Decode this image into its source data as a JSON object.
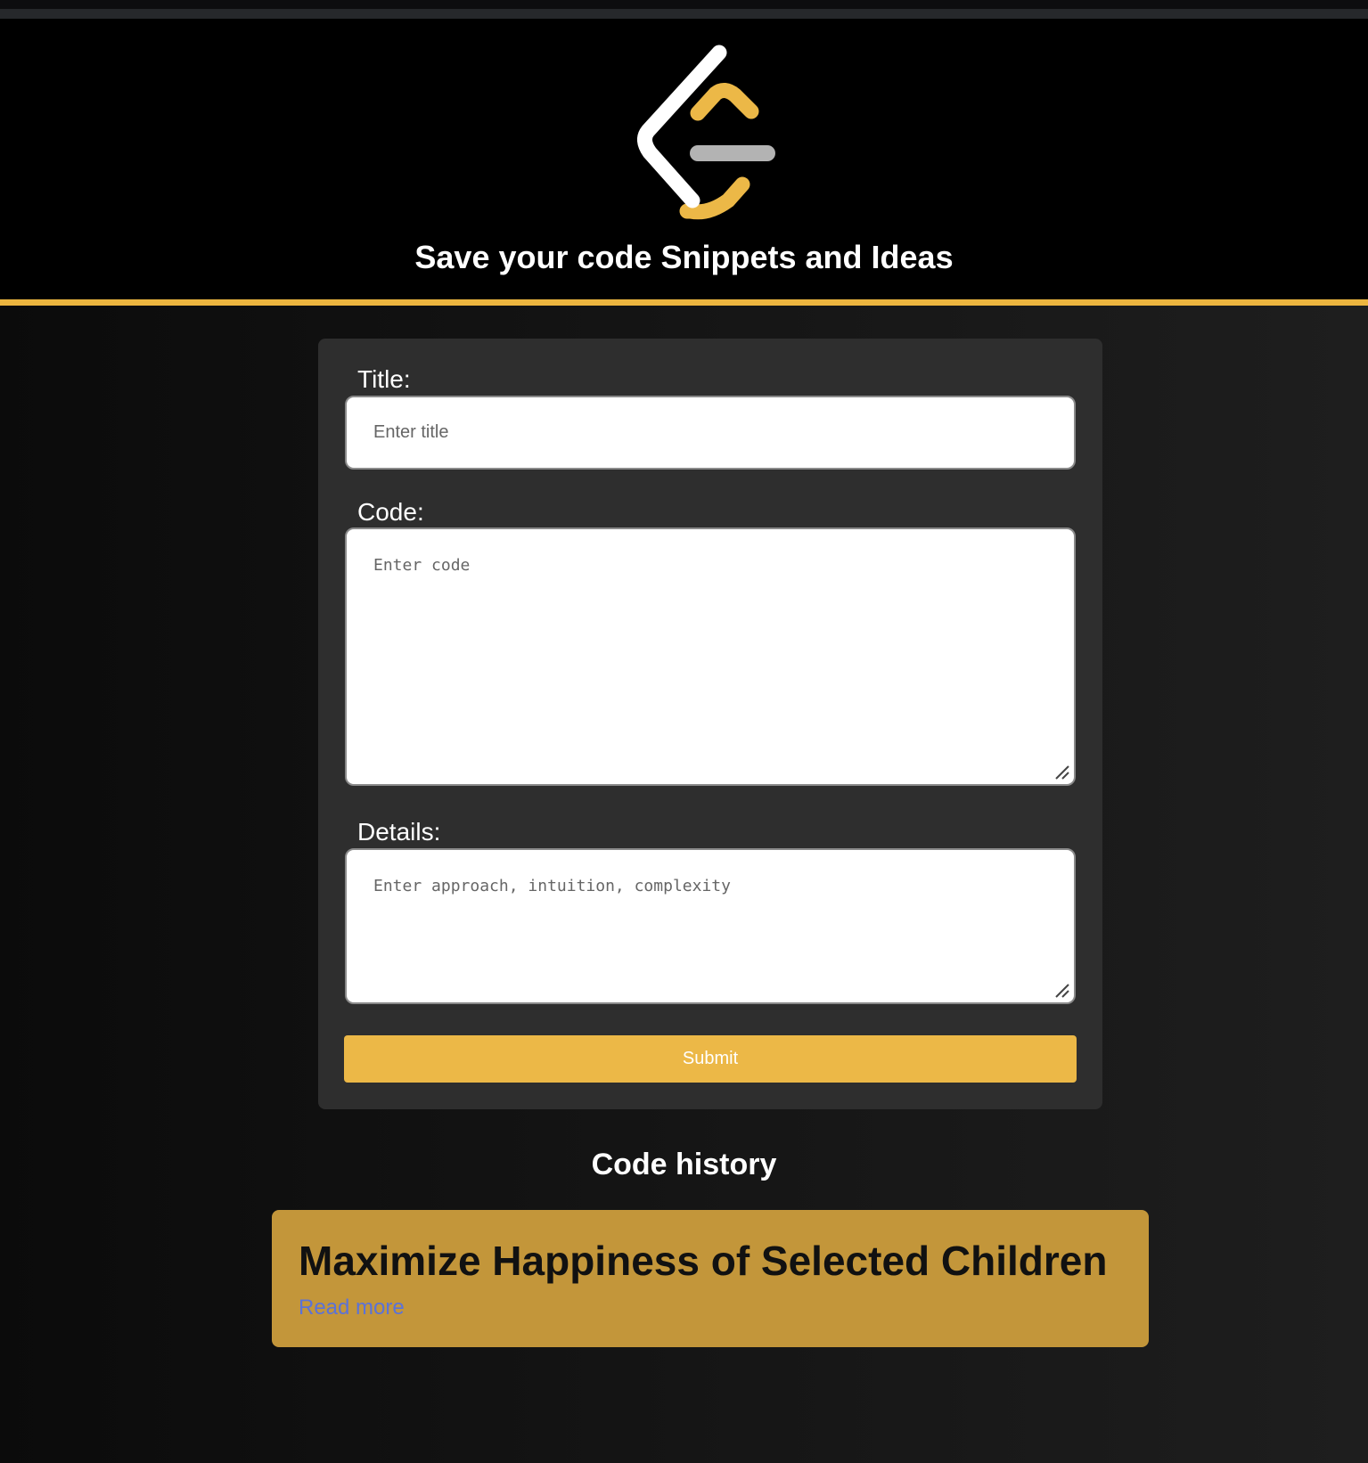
{
  "header": {
    "logo_icon": "leetcode-logo-icon",
    "title": "Save your code Snippets and Ideas"
  },
  "form": {
    "title_label": "Title:",
    "title_placeholder": "Enter title",
    "code_label": "Code:",
    "code_placeholder": "Enter code",
    "details_label": "Details:",
    "details_placeholder": "Enter approach, intuition, complexity",
    "submit_label": "Submit"
  },
  "history": {
    "heading": "Code history",
    "items": [
      {
        "title": "Maximize Happiness of Selected Children",
        "link_label": "Read more"
      }
    ]
  },
  "colors": {
    "accent": "#ecb847",
    "card_background": "#c3963a",
    "link": "#5b72d8",
    "form_background": "#2e2e2e"
  }
}
